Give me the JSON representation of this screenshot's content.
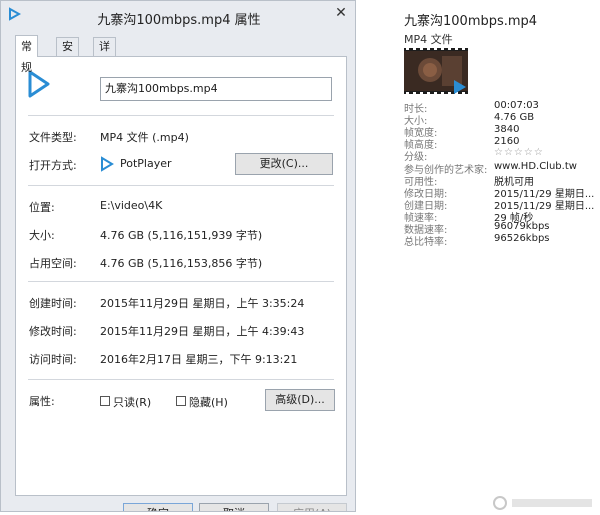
{
  "dialog": {
    "title": "九寨沟100mbps.mp4 属性",
    "close_glyph": "✕",
    "tabs": [
      "常规",
      "安全",
      "详细信息"
    ],
    "file_name": "九寨沟100mbps.mp4",
    "file_type_label": "文件类型:",
    "file_type": "MP4 文件 (.mp4)",
    "opens_with_label": "打开方式:",
    "opens_with": "PotPlayer",
    "change_button": "更改(C)...",
    "location_label": "位置:",
    "location": "E:\\video\\4K",
    "size_label": "大小:",
    "size": "4.76 GB (5,116,151,939 字节)",
    "size_on_disk_label": "占用空间:",
    "size_on_disk": "4.76 GB (5,116,153,856 字节)",
    "created_label": "创建时间:",
    "created": "2015年11月29日 星期日，上午 3:35:24",
    "modified_label": "修改时间:",
    "modified": "2015年11月29日 星期日，上午 4:39:43",
    "accessed_label": "访问时间:",
    "accessed": "2016年2月17日 星期三，下午 9:13:21",
    "attributes_label": "属性:",
    "readonly_label": "只读(R)",
    "hidden_label": "隐藏(H)",
    "advanced_button": "高级(D)...",
    "ok_button": "确定",
    "cancel_button": "取消",
    "apply_button": "应用(A)"
  },
  "details": {
    "title": "九寨沟100mbps.mp4",
    "type": "MP4 文件",
    "rows": [
      {
        "key": "时长:",
        "value": "00:07:03"
      },
      {
        "key": "大小:",
        "value": "4.76 GB"
      },
      {
        "key": "帧宽度:",
        "value": "3840"
      },
      {
        "key": "帧高度:",
        "value": "2160"
      },
      {
        "key": "分级:",
        "value": ""
      },
      {
        "key": "参与创作的艺术家:",
        "value": "www.HD.Club.tw"
      },
      {
        "key": "可用性:",
        "value": "脱机可用"
      },
      {
        "key": "修改日期:",
        "value": "2015/11/29 星期日..."
      },
      {
        "key": "创建日期:",
        "value": "2015/11/29 星期日..."
      },
      {
        "key": "帧速率:",
        "value": "29 帧/秒"
      },
      {
        "key": "数据速率:",
        "value": "96079kbps"
      },
      {
        "key": "总比特率:",
        "value": "96526kbps"
      }
    ],
    "rating_stars": "☆☆☆☆☆"
  },
  "colors": {
    "accent": "#2a8dd4",
    "dialog_bg": "#e8ebf0"
  },
  "icons": [
    "play-icon",
    "potplayer-icon",
    "close-icon",
    "video-thumbnail"
  ]
}
